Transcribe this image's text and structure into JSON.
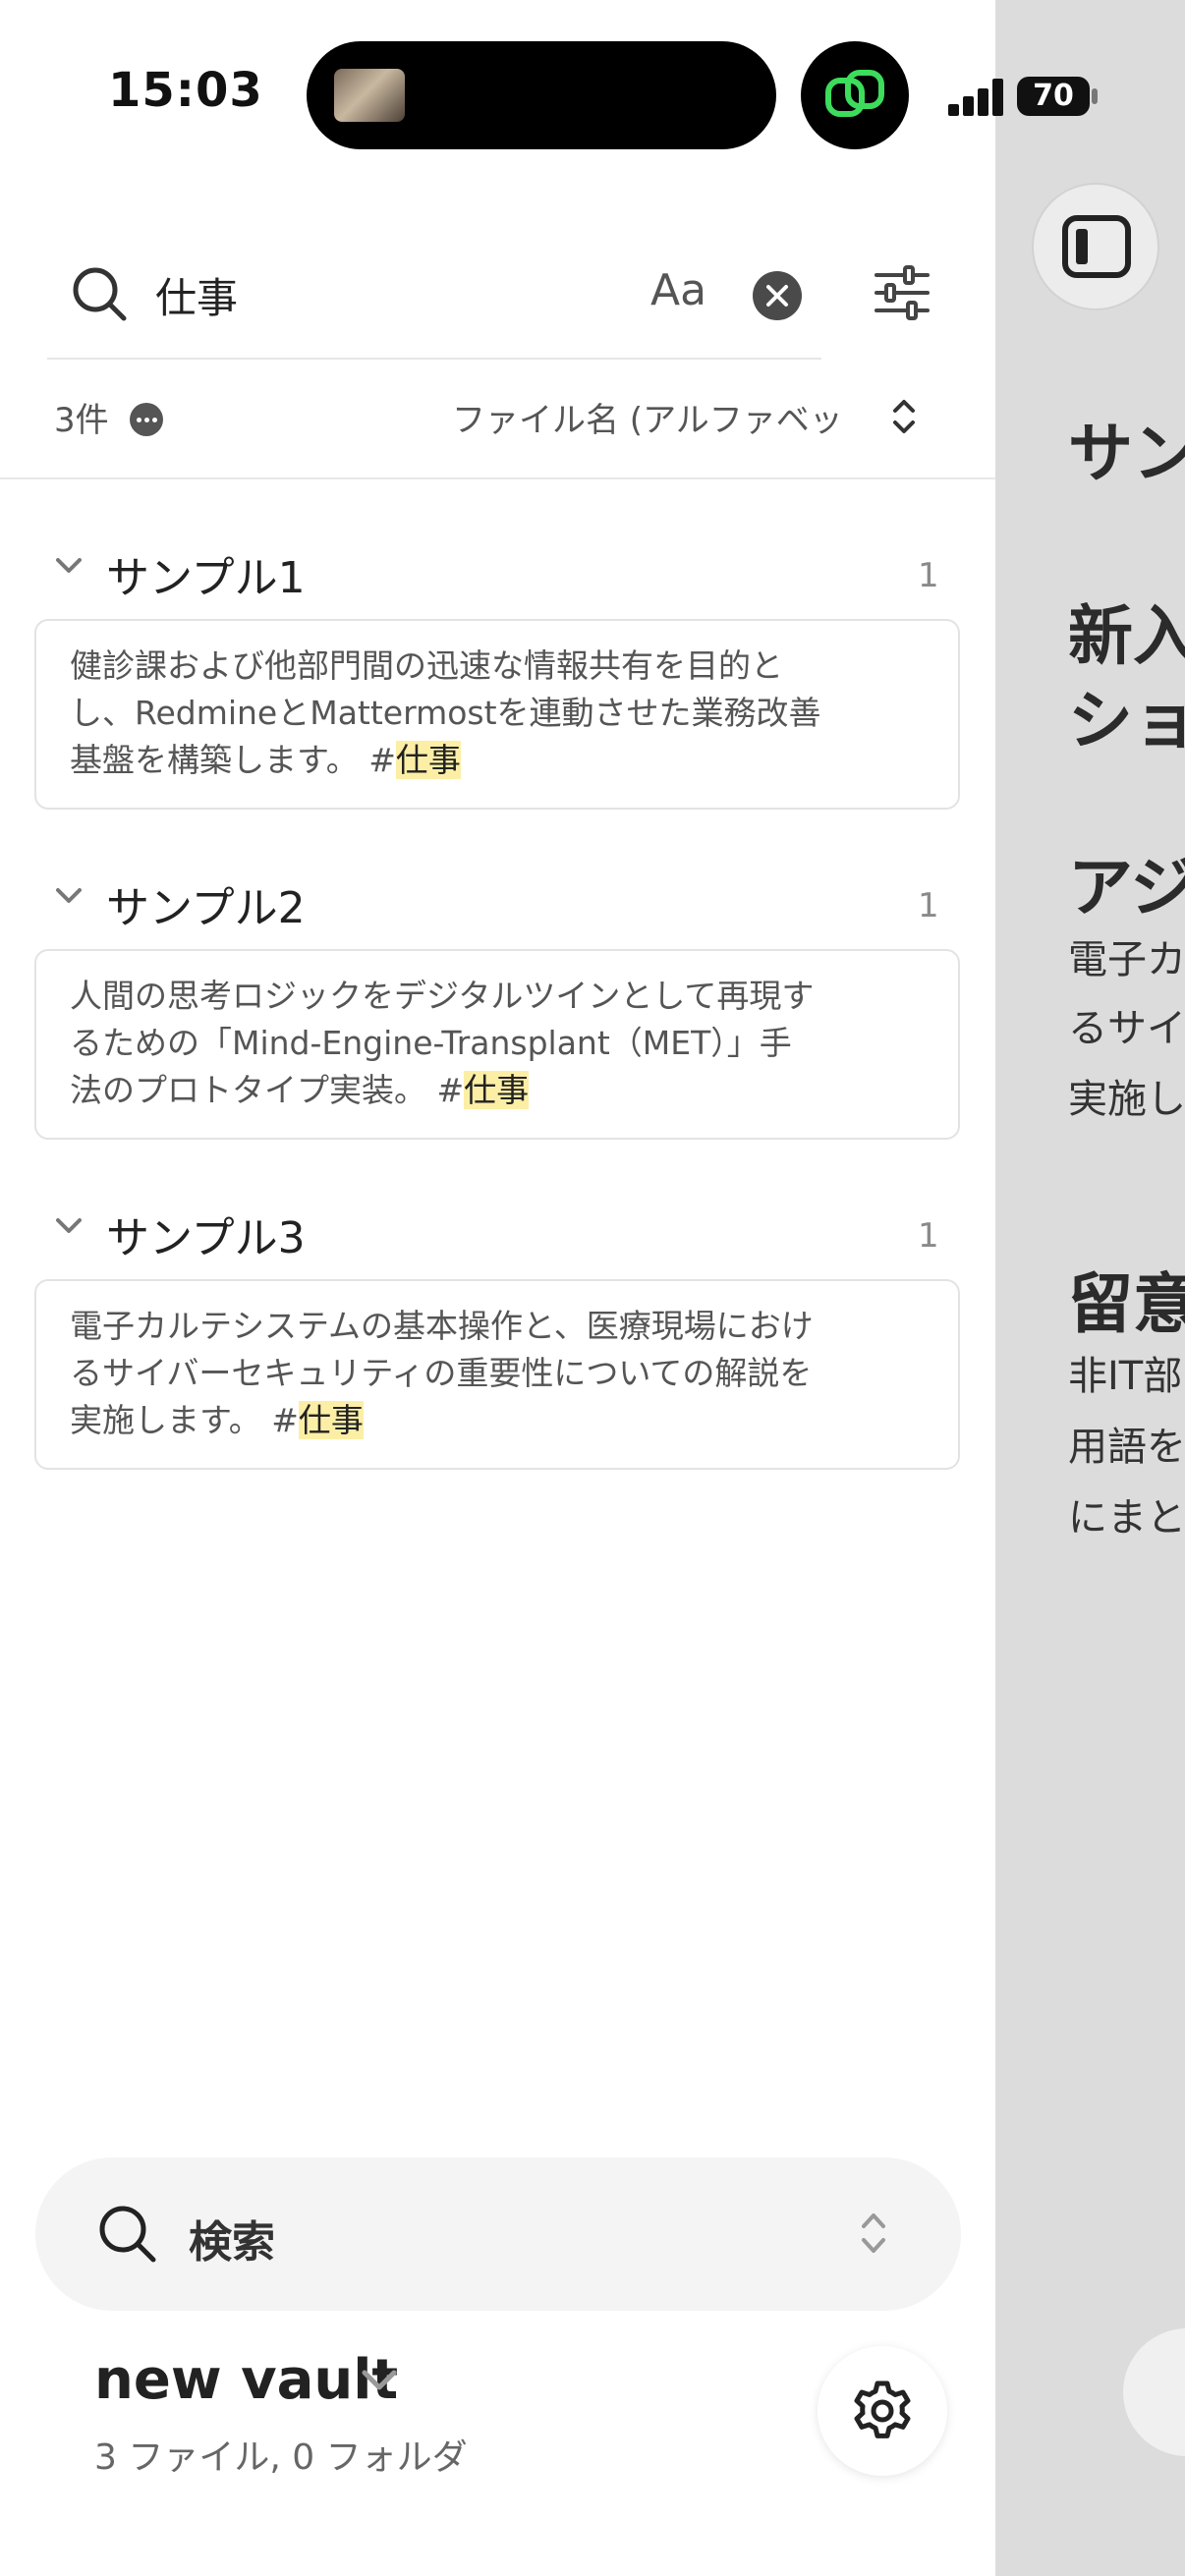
{
  "status_bar": {
    "time": "15:03",
    "battery": "70"
  },
  "search": {
    "query": "仕事",
    "match_case_label": "Aa"
  },
  "results_meta": {
    "count": "3件",
    "sort_label": "ファイル名 (アルファベッ"
  },
  "results": [
    {
      "file": "サンプル1",
      "matches": "1",
      "lines": [
        "健診課および他部門間の迅速な情報共有を目的と",
        "し、RedmineとMattermostを連動させた業務改善"
      ],
      "last_prefix": "基盤を構築します。 #",
      "highlight": "仕事"
    },
    {
      "file": "サンプル2",
      "matches": "1",
      "lines": [
        "人間の思考ロジックをデジタルツインとして再現す",
        "るための「Mind-Engine-Transplant（MET）」手"
      ],
      "last_prefix": "法のプロトタイプ実装。 #",
      "highlight": "仕事"
    },
    {
      "file": "サンプル3",
      "matches": "1",
      "lines": [
        "電子カルテシステムの基本操作と、医療現場におけ",
        "るサイバーセキュリティの重要性についての解説を"
      ],
      "last_prefix": "実施します。 #",
      "highlight": "仕事"
    }
  ],
  "bottom": {
    "search_label": "検索",
    "vault_name": "new vault",
    "vault_stats": "3 ファイル, 0 フォルダ"
  },
  "background_note": {
    "heading1": "サン",
    "heading2a": "新入",
    "heading2b": "ショ",
    "heading3": "アジ",
    "para1": [
      "電子カ",
      "るサイ",
      "実施し"
    ],
    "heading4": "留意",
    "para2": [
      "非IT部",
      "用語を",
      "にまと"
    ]
  },
  "colors": {
    "highlight": "#fcefa5",
    "right_pane": "#dcdcdc",
    "app_icon": "#3ddc5c"
  }
}
